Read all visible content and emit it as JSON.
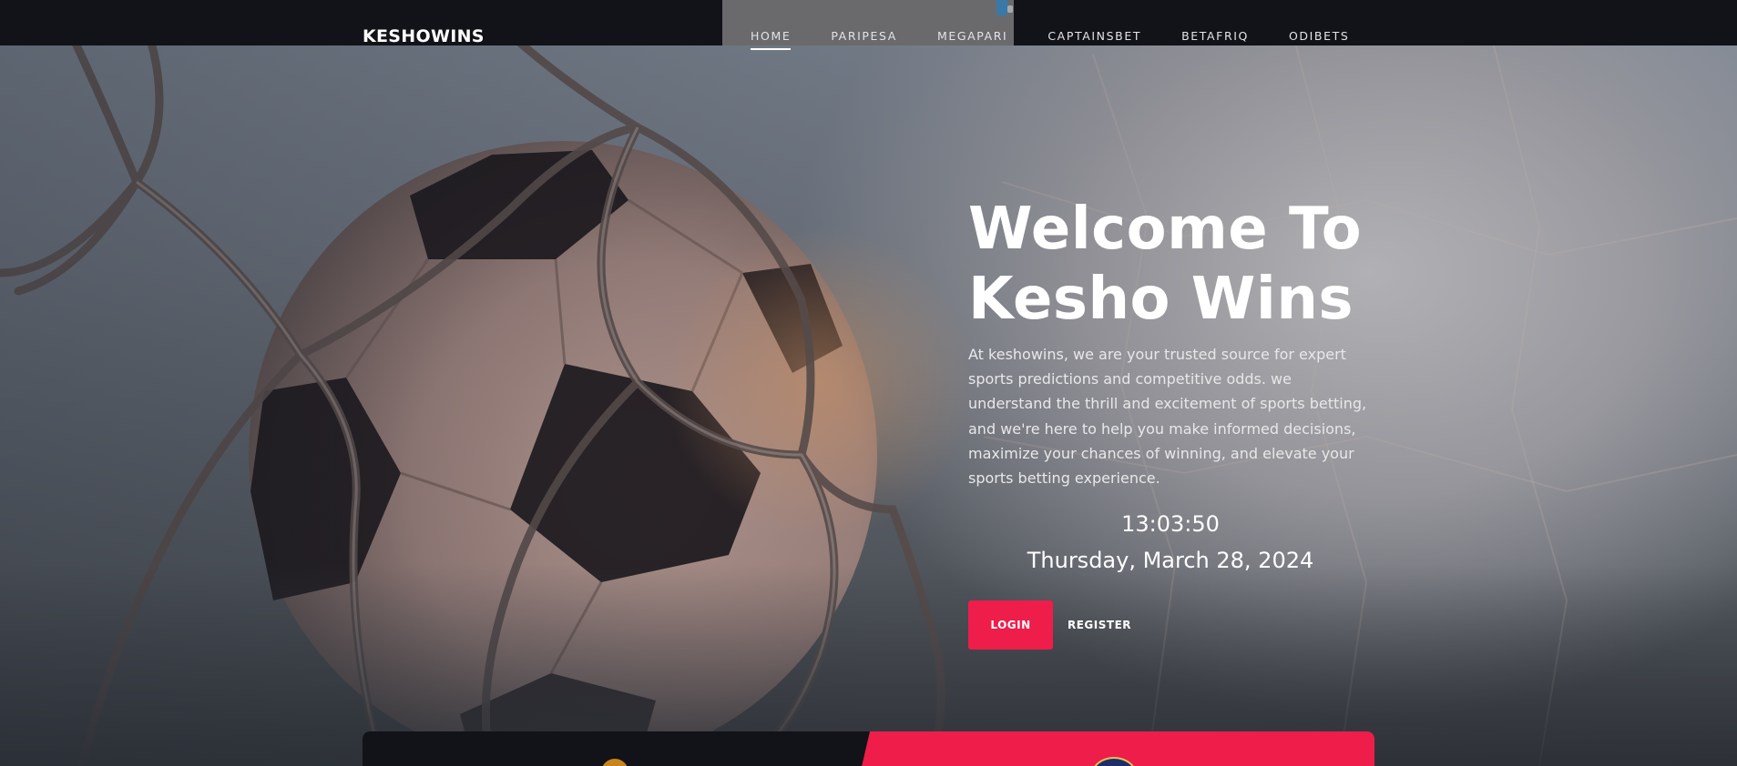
{
  "brand": {
    "name": "KESHOWINS"
  },
  "nav": {
    "items": [
      {
        "label": "HOME",
        "active": true
      },
      {
        "label": "PARIPESA",
        "active": false
      },
      {
        "label": "MEGAPARI",
        "active": false
      },
      {
        "label": "CAPTAINSBET",
        "active": false
      },
      {
        "label": "BETAFRIQ",
        "active": false
      },
      {
        "label": "ODIBETS",
        "active": false
      }
    ]
  },
  "hero": {
    "title_line1": "Welcome To",
    "title_line2": "Kesho Wins",
    "description": "At keshowins, we are your trusted source for expert sports predictions and competitive odds. we understand the thrill and excitement of sports betting, and we're here to help you make informed decisions, maximize your chances of winning, and elevate your sports betting experience.",
    "clock_time": "13:03:50",
    "clock_date": "Thursday, March 28, 2024",
    "login_label": "LOGIN",
    "register_label": "REGISTER"
  },
  "colors": {
    "accent": "#ee1d4a",
    "navbar": "#111318",
    "text": "#ffffff"
  },
  "icons": {
    "background_image": "soccer-ball-in-net-photo",
    "left_crest": "team-crest-icon",
    "right_crest": "team-crest-icon"
  }
}
